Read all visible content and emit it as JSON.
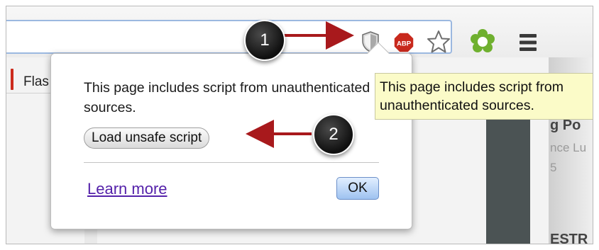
{
  "browser": {
    "tab_label": "Flas",
    "icons": [
      "shield-icon",
      "adblock-plus-icon",
      "bookmark-star-icon",
      "extension-icon",
      "menu-icon"
    ],
    "adblock_text": "ABP"
  },
  "popup": {
    "message": "This page includes script from unauthenticated sources.",
    "load_unsafe_label": "Load unsafe script",
    "learn_more_label": "Learn more",
    "ok_label": "OK"
  },
  "tooltip": {
    "line1": "This page includes script from",
    "line2": "unauthenticated sources."
  },
  "callouts": {
    "one": "1",
    "two": "2"
  },
  "background_page": {
    "frag1": "g Po",
    "frag2": "nce Lu",
    "frag3": "5",
    "frag4": "ESTR"
  },
  "colors": {
    "callout_arrow": "#a8191c",
    "link": "#5522aa",
    "tooltip_bg": "#fbfbc8",
    "ok_button": "#9ec2f0",
    "adblock_red": "#c8291d",
    "extension_green": "#6fb02f"
  }
}
